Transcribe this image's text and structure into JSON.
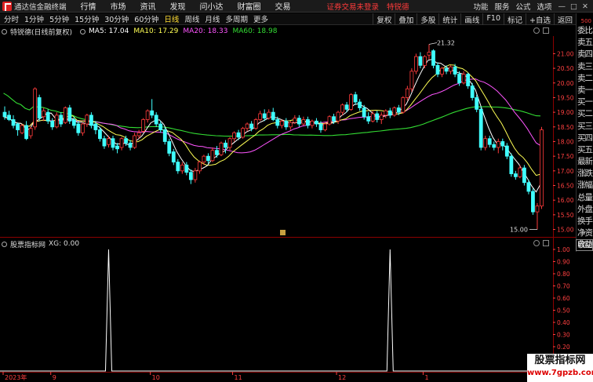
{
  "menubar": {
    "app_title": "通达信金融终端",
    "items": [
      "行情",
      "市场",
      "资讯",
      "发现",
      "问小达",
      "财富圈",
      "交易"
    ],
    "login_status": "证券交易未登录",
    "stock_title": "特锐德",
    "right_items": [
      "功能",
      "服务",
      "公式",
      "选项"
    ],
    "window_buttons": [
      "—",
      "□",
      "✕"
    ],
    "guest_label": "游客"
  },
  "toolbar": {
    "periods": [
      "分时",
      "1分钟",
      "5分钟",
      "15分钟",
      "30分钟",
      "60分钟",
      "日线",
      "周线",
      "月线",
      "多周期",
      "更多"
    ],
    "active_period": "日线",
    "right_buttons": [
      "复权",
      "叠加",
      "多股",
      "统计",
      "画线",
      "F10",
      "标记",
      "+自选",
      "返回"
    ]
  },
  "chart_info": {
    "title": "特锐德(日线前复权)",
    "ma5": "MA5: 17.04",
    "ma10": "MA10: 17.29",
    "ma20": "MA20: 18.33",
    "ma60": "MA60: 18.98"
  },
  "indicator": {
    "name": "股票指标网",
    "xg": "XG: 0.00"
  },
  "side_panel": {
    "top_num": "500",
    "items": [
      "委比",
      "卖五",
      "卖四",
      "卖三",
      "卖二",
      "卖一",
      "买一",
      "买二",
      "买三",
      "买四",
      "买五",
      "最新",
      "涨跌",
      "涨幅",
      "总量",
      "外盘",
      "换手",
      "净资",
      "收益"
    ],
    "auto_label": "自动"
  },
  "watermark": {
    "title": "股票指标网",
    "url": "www.7gpzb.com"
  },
  "colors": {
    "up": "#ff3b3b",
    "down": "#40ffff",
    "ma5": "#ffffff",
    "ma10": "#ffff55",
    "ma20": "#ff55ff",
    "ma60": "#33dd33",
    "axis_grid": "#8b0000",
    "axis_label": "#ff4040"
  },
  "chart_data": [
    {
      "type": "candlestick",
      "title": "特锐德(日线前复权)",
      "y_ticks": [
        "21.00",
        "20.50",
        "20.00",
        "19.50",
        "19.00",
        "18.50",
        "18.00",
        "17.50",
        "17.00",
        "16.50",
        "16.00",
        "15.50",
        "15.00"
      ],
      "ylim": [
        14.8,
        21.6
      ],
      "annotations": [
        {
          "label": "21.32",
          "index": 98
        },
        {
          "label": "15.00",
          "index": 123
        }
      ],
      "x_ticks": [
        {
          "label": "2023年",
          "index": 0
        },
        {
          "label": "9",
          "index": 11
        },
        {
          "label": "10",
          "index": 34
        },
        {
          "label": "11",
          "index": 53
        },
        {
          "label": "12",
          "index": 77
        },
        {
          "label": "1",
          "index": 97
        }
      ],
      "candles": [
        [
          19.0,
          18.85,
          19.2,
          18.75
        ],
        [
          18.9,
          18.75,
          19.05,
          18.7
        ],
        [
          18.75,
          18.55,
          18.9,
          18.45
        ],
        [
          18.6,
          18.4,
          18.65,
          18.2
        ],
        [
          18.3,
          18.55,
          18.6,
          18.25
        ],
        [
          18.55,
          18.1,
          18.7,
          18.05
        ],
        [
          18.2,
          18.45,
          18.5,
          18.1
        ],
        [
          18.5,
          19.8,
          19.85,
          18.4
        ],
        [
          19.5,
          18.8,
          19.6,
          18.7
        ],
        [
          18.85,
          19.05,
          19.15,
          18.7
        ],
        [
          19.0,
          18.7,
          19.1,
          18.6
        ],
        [
          18.7,
          18.5,
          18.8,
          18.4
        ],
        [
          18.5,
          18.9,
          19.0,
          18.45
        ],
        [
          18.9,
          18.6,
          19.0,
          18.5
        ],
        [
          18.65,
          19.15,
          19.2,
          18.6
        ],
        [
          19.15,
          18.7,
          19.25,
          18.6
        ],
        [
          18.75,
          18.55,
          18.85,
          18.45
        ],
        [
          18.6,
          18.3,
          18.7,
          18.2
        ],
        [
          18.3,
          18.6,
          18.65,
          18.2
        ],
        [
          18.6,
          18.9,
          18.95,
          18.5
        ],
        [
          18.9,
          18.55,
          19.0,
          18.45
        ],
        [
          18.6,
          18.4,
          18.7,
          18.25
        ],
        [
          18.4,
          18.1,
          18.5,
          18.0
        ],
        [
          18.1,
          17.85,
          18.2,
          17.75
        ],
        [
          17.9,
          18.1,
          18.2,
          17.8
        ],
        [
          18.1,
          17.8,
          18.2,
          17.7
        ],
        [
          17.85,
          17.75,
          17.95,
          17.6
        ],
        [
          17.8,
          18.1,
          18.15,
          17.7
        ],
        [
          18.1,
          17.95,
          18.2,
          17.85
        ],
        [
          17.95,
          17.8,
          18.05,
          17.7
        ],
        [
          17.8,
          18.2,
          18.3,
          17.75
        ],
        [
          18.2,
          18.3,
          18.4,
          18.1
        ],
        [
          18.35,
          18.75,
          18.8,
          18.3
        ],
        [
          18.75,
          19.05,
          19.1,
          18.65
        ],
        [
          19.05,
          18.9,
          19.45,
          18.8
        ],
        [
          18.9,
          18.6,
          19.0,
          18.5
        ],
        [
          18.6,
          18.4,
          18.7,
          18.3
        ],
        [
          18.4,
          18.0,
          18.5,
          17.9
        ],
        [
          18.0,
          17.6,
          18.1,
          17.5
        ],
        [
          17.65,
          17.3,
          17.75,
          17.2
        ],
        [
          17.3,
          17.0,
          17.4,
          16.9
        ],
        [
          17.0,
          17.2,
          17.3,
          16.9
        ],
        [
          17.2,
          16.95,
          17.3,
          16.85
        ],
        [
          16.95,
          16.7,
          17.05,
          16.55
        ],
        [
          16.7,
          17.0,
          17.1,
          16.6
        ],
        [
          17.0,
          17.3,
          17.35,
          16.9
        ],
        [
          17.3,
          17.5,
          17.55,
          17.2
        ],
        [
          17.5,
          17.35,
          17.6,
          17.25
        ],
        [
          17.35,
          17.7,
          17.8,
          17.3
        ],
        [
          17.7,
          17.55,
          17.85,
          17.45
        ],
        [
          17.55,
          17.95,
          18.0,
          17.5
        ],
        [
          17.95,
          17.8,
          18.05,
          17.6
        ],
        [
          17.8,
          18.1,
          18.15,
          17.7
        ],
        [
          18.1,
          18.3,
          18.35,
          18.0
        ],
        [
          18.3,
          18.15,
          18.4,
          18.05
        ],
        [
          18.15,
          18.45,
          18.5,
          18.1
        ],
        [
          18.45,
          18.6,
          18.65,
          18.35
        ],
        [
          18.6,
          18.45,
          18.7,
          18.35
        ],
        [
          18.45,
          18.75,
          18.8,
          18.4
        ],
        [
          18.75,
          18.95,
          19.05,
          18.7
        ],
        [
          18.95,
          18.8,
          19.1,
          18.7
        ],
        [
          18.8,
          19.0,
          19.1,
          18.75
        ],
        [
          19.0,
          18.75,
          19.15,
          18.7
        ],
        [
          18.75,
          18.55,
          18.85,
          18.45
        ],
        [
          18.55,
          18.7,
          18.75,
          18.45
        ],
        [
          18.7,
          18.5,
          18.8,
          18.4
        ],
        [
          18.5,
          18.65,
          18.7,
          18.4
        ],
        [
          18.65,
          18.8,
          18.9,
          18.6
        ],
        [
          18.8,
          18.6,
          18.9,
          18.5
        ],
        [
          18.6,
          18.75,
          18.85,
          18.55
        ],
        [
          18.75,
          18.55,
          18.85,
          18.45
        ],
        [
          18.55,
          18.7,
          18.75,
          18.45
        ],
        [
          18.7,
          18.6,
          18.8,
          18.5
        ],
        [
          18.6,
          18.4,
          18.7,
          18.3
        ],
        [
          18.4,
          18.6,
          18.65,
          18.35
        ],
        [
          18.6,
          18.85,
          18.9,
          18.55
        ],
        [
          18.85,
          18.7,
          18.95,
          18.6
        ],
        [
          18.7,
          19.0,
          19.05,
          18.6
        ],
        [
          19.0,
          19.25,
          19.3,
          18.9
        ],
        [
          19.25,
          19.1,
          19.35,
          19.0
        ],
        [
          19.1,
          19.6,
          19.65,
          19.05
        ],
        [
          19.6,
          19.35,
          19.7,
          19.25
        ],
        [
          19.35,
          19.15,
          19.45,
          19.05
        ],
        [
          19.15,
          18.85,
          19.25,
          18.75
        ],
        [
          18.85,
          18.7,
          19.0,
          18.6
        ],
        [
          18.7,
          18.95,
          19.05,
          18.65
        ],
        [
          18.95,
          18.75,
          19.05,
          18.65
        ],
        [
          18.75,
          18.9,
          19.0,
          18.6
        ],
        [
          18.9,
          19.05,
          19.1,
          18.8
        ],
        [
          19.05,
          18.9,
          19.15,
          18.8
        ],
        [
          18.9,
          19.15,
          19.2,
          18.85
        ],
        [
          19.15,
          19.0,
          19.25,
          18.9
        ],
        [
          19.0,
          19.5,
          19.55,
          18.95
        ],
        [
          19.5,
          19.8,
          19.9,
          19.4
        ],
        [
          19.8,
          20.4,
          20.5,
          19.7
        ],
        [
          20.4,
          20.9,
          21.0,
          20.3
        ],
        [
          20.9,
          20.6,
          21.05,
          20.5
        ],
        [
          20.6,
          20.9,
          20.95,
          20.5
        ],
        [
          20.95,
          21.05,
          21.32,
          20.8
        ],
        [
          21.1,
          20.6,
          21.15,
          20.5
        ],
        [
          20.6,
          20.3,
          20.7,
          20.2
        ],
        [
          20.3,
          20.5,
          20.55,
          20.2
        ],
        [
          20.5,
          20.4,
          20.6,
          20.3
        ],
        [
          20.4,
          20.55,
          20.6,
          20.3
        ],
        [
          20.55,
          20.3,
          20.65,
          20.2
        ],
        [
          20.3,
          20.0,
          20.4,
          19.9
        ],
        [
          20.0,
          20.3,
          20.4,
          19.95
        ],
        [
          20.3,
          19.9,
          20.35,
          19.8
        ],
        [
          19.9,
          19.5,
          20.0,
          19.4
        ],
        [
          19.5,
          19.1,
          19.6,
          19.0
        ],
        [
          19.1,
          17.8,
          19.2,
          17.7
        ],
        [
          17.8,
          18.1,
          18.2,
          17.7
        ],
        [
          18.1,
          17.9,
          18.2,
          17.8
        ],
        [
          17.9,
          17.8,
          18.0,
          17.7
        ],
        [
          17.8,
          18.0,
          18.1,
          17.6
        ],
        [
          18.0,
          17.85,
          18.1,
          17.7
        ],
        [
          17.85,
          17.5,
          17.95,
          17.4
        ],
        [
          17.5,
          16.9,
          17.6,
          16.8
        ],
        [
          16.9,
          16.8,
          17.0,
          16.7
        ],
        [
          16.8,
          17.1,
          17.2,
          16.75
        ],
        [
          17.1,
          16.6,
          17.2,
          16.5
        ],
        [
          16.6,
          16.3,
          16.7,
          16.2
        ],
        [
          16.3,
          15.6,
          16.4,
          15.5
        ],
        [
          15.6,
          15.8,
          15.9,
          15.0
        ],
        [
          15.8,
          18.4,
          18.5,
          15.7
        ]
      ]
    },
    {
      "type": "line",
      "series": [
        {
          "name": "XG",
          "values": [
            0,
            1,
            0,
            0
          ]
        }
      ],
      "spikes": [
        {
          "index": 24,
          "value": 1.0
        },
        {
          "index": 89,
          "value": 1.0
        }
      ],
      "y_ticks": [
        "1.00",
        "0.90",
        "0.80",
        "0.70",
        "0.60",
        "0.50",
        "0.40",
        "0.30",
        "0.20",
        "0.10",
        "0.00"
      ],
      "ylim": [
        0,
        1.0
      ]
    }
  ]
}
